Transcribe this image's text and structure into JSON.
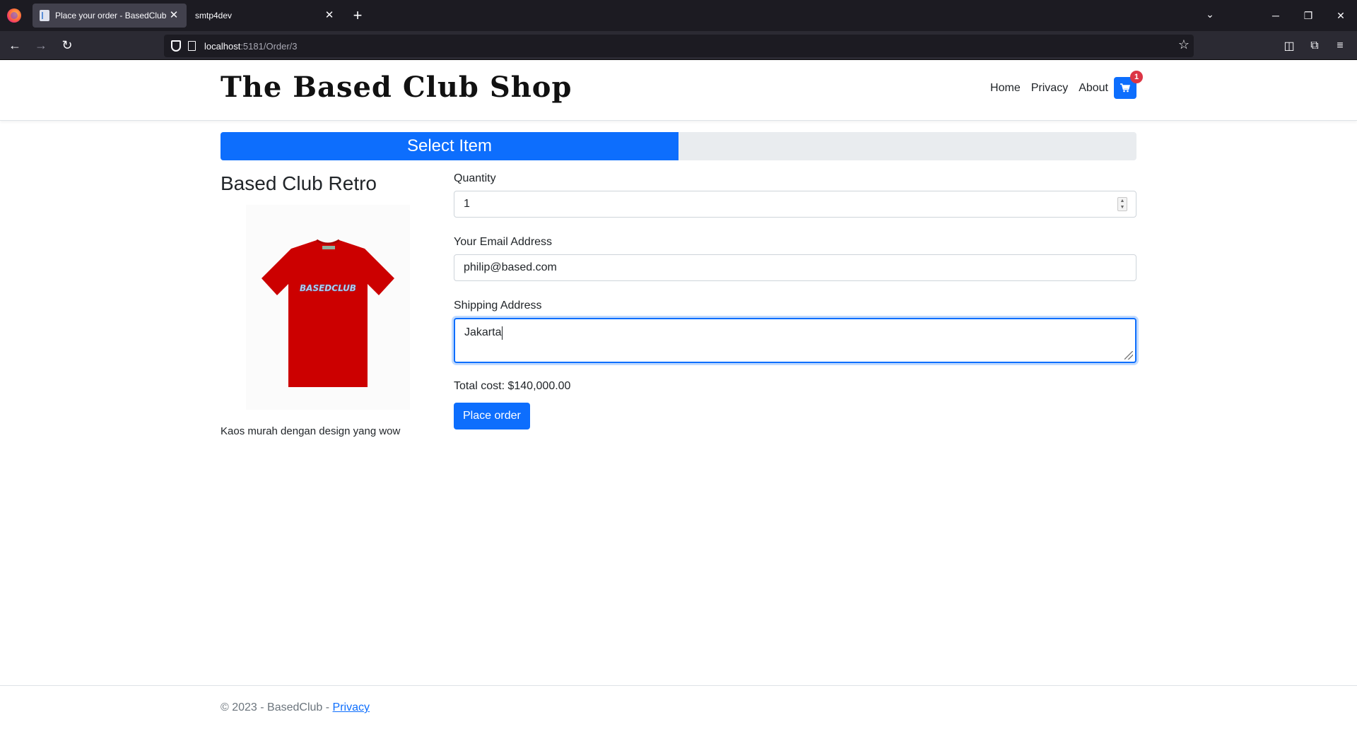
{
  "browser": {
    "tabs": [
      {
        "title": "Place your order - BasedClub",
        "active": true
      },
      {
        "title": "smtp4dev",
        "active": false
      }
    ],
    "url_host": "localhost",
    "url_path": ":5181/Order/3"
  },
  "site": {
    "brand": "The Based Club Shop",
    "nav": {
      "home": "Home",
      "privacy": "Privacy",
      "about": "About"
    },
    "cart_count": "1"
  },
  "progress": {
    "label": "Select Item",
    "fraction": 0.5
  },
  "product": {
    "title": "Based Club Retro",
    "shirt_print": "BASEDCLUB",
    "description": "Kaos murah dengan design yang wow"
  },
  "form": {
    "quantity_label": "Quantity",
    "quantity_value": "1",
    "email_label": "Your Email Address",
    "email_value": "philip@based.com",
    "address_label": "Shipping Address",
    "address_value": "Jakarta",
    "total": "Total cost: $140,000.00",
    "submit_label": "Place order"
  },
  "footer": {
    "copyright": "© 2023 - BasedClub - ",
    "privacy_link": "Privacy"
  },
  "colors": {
    "primary": "#0d6efd",
    "badge": "#dc3545",
    "shirt": "#cc0000"
  }
}
